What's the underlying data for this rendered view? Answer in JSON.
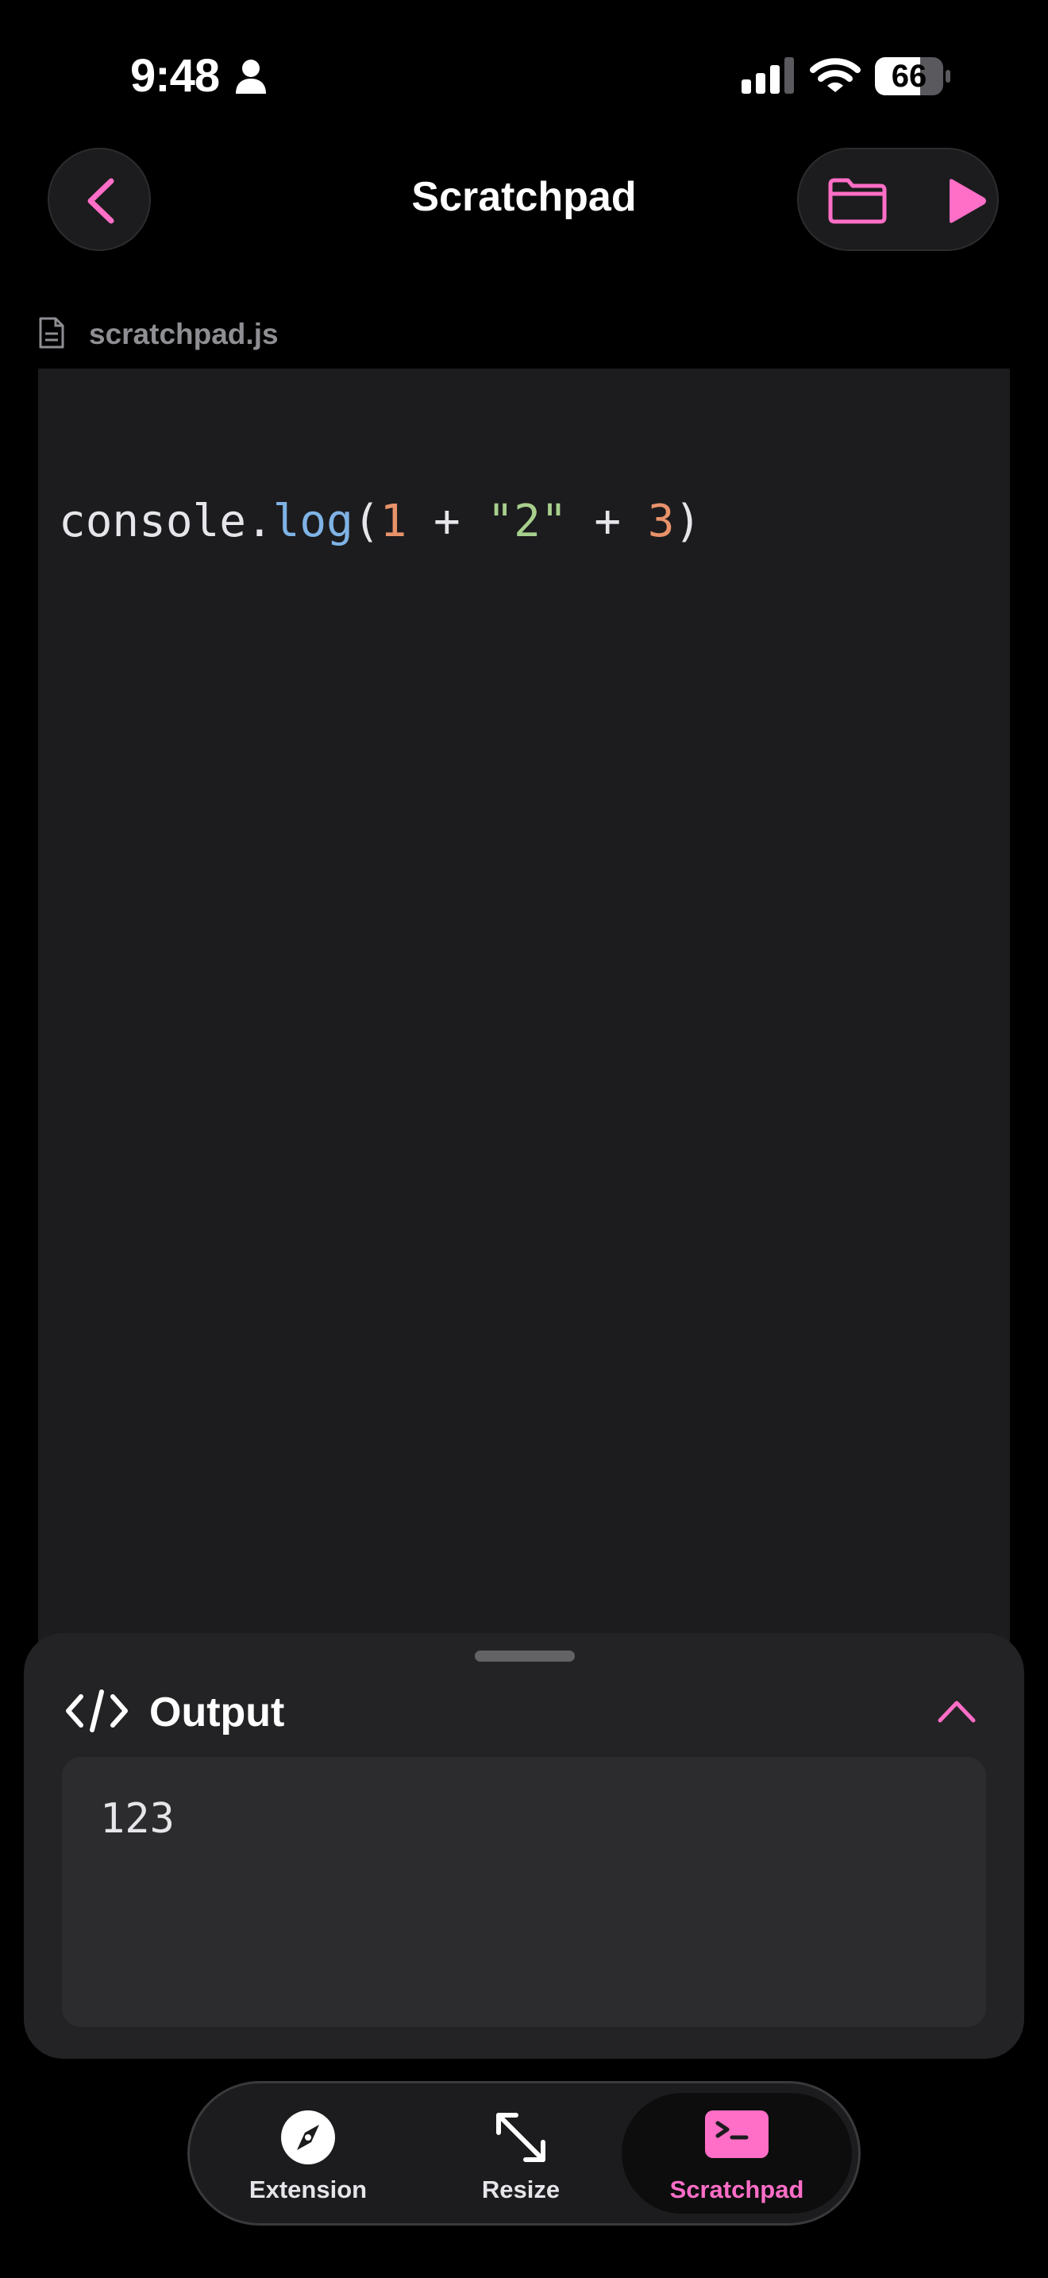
{
  "status_bar": {
    "time": "9:48",
    "battery": "66",
    "icons": [
      "person-icon",
      "cellular-signal-icon",
      "wifi-icon",
      "battery-icon"
    ]
  },
  "header": {
    "title": "Scratchpad",
    "back_icon": "chevron-left-icon",
    "actions": [
      "folder-icon",
      "play-icon"
    ]
  },
  "file": {
    "name": "scratchpad.js",
    "icon": "document-icon"
  },
  "editor": {
    "tokens": {
      "obj": "console.",
      "fn": "log",
      "open": "(",
      "n1": "1",
      "op1": " + ",
      "str": "\"2\"",
      "op2": " + ",
      "n2": "3",
      "close": ")"
    }
  },
  "output": {
    "title": "Output",
    "icon": "code-brackets-icon",
    "toggle_icon": "chevron-up-icon",
    "result": "123"
  },
  "tab_bar": {
    "active": "Scratchpad",
    "tabs": [
      {
        "label": "Extension",
        "icon": "compass-icon"
      },
      {
        "label": "Resize",
        "icon": "resize-arrows-icon"
      },
      {
        "label": "Scratchpad",
        "icon": "terminal-icon"
      }
    ]
  },
  "colors": {
    "accent": "#ff6ec7",
    "background": "#000000",
    "editor_bg": "#1c1c1e",
    "code_function": "#7fb3e6",
    "code_number": "#e8926a",
    "code_string": "#a8d08d"
  }
}
